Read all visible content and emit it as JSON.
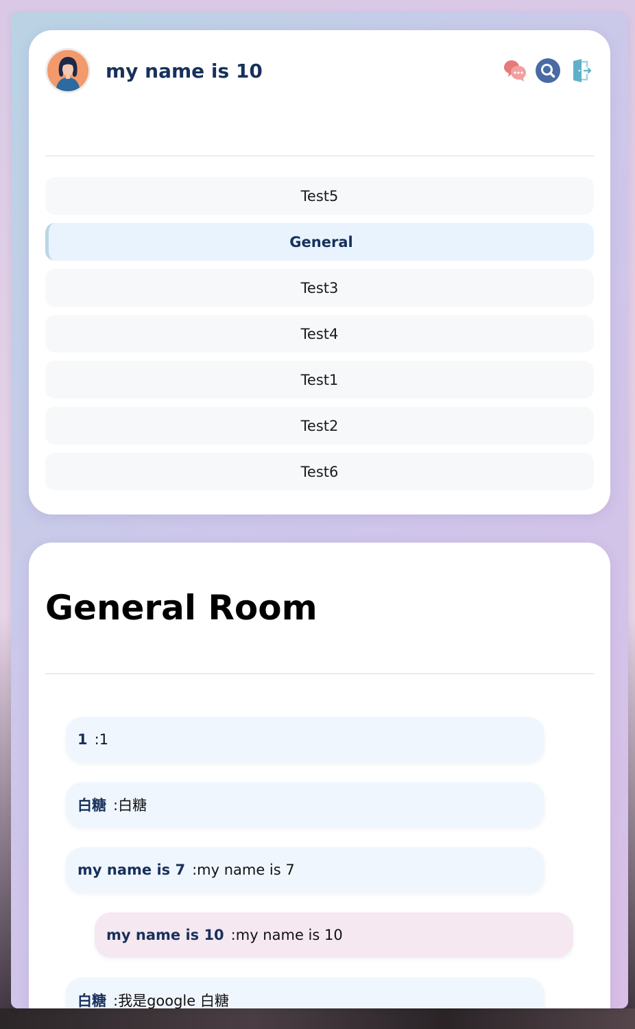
{
  "user": {
    "name": "my name is 10"
  },
  "header_icons": [
    "chat-bubbles-icon",
    "search-icon",
    "logout-door-icon"
  ],
  "rooms": [
    {
      "label": "Test5",
      "active": false
    },
    {
      "label": "General",
      "active": true
    },
    {
      "label": "Test3",
      "active": false
    },
    {
      "label": "Test4",
      "active": false
    },
    {
      "label": "Test1",
      "active": false
    },
    {
      "label": "Test2",
      "active": false
    },
    {
      "label": "Test6",
      "active": false
    }
  ],
  "room": {
    "title": "General Room"
  },
  "messages": [
    {
      "sender": "1",
      "text": ":1",
      "own": false
    },
    {
      "sender": "白糖",
      "text": ":白糖",
      "own": false
    },
    {
      "sender": "my name is 7",
      "text": ":my name is 7",
      "own": false
    },
    {
      "sender": "my name is 10",
      "text": ":my name is 10",
      "own": true
    },
    {
      "sender": "白糖",
      "text": ":我是google 白糖",
      "own": false
    }
  ],
  "colors": {
    "accent": "#17315b",
    "active_room_bg": "#e8f3fd",
    "msg_bg": "#f0f6fe",
    "own_msg_bg": "#f5e8f1",
    "chat_icon": "#e77b7b",
    "search_icon": "#4a6aa5",
    "logout_icon": "#5fb0c8"
  }
}
